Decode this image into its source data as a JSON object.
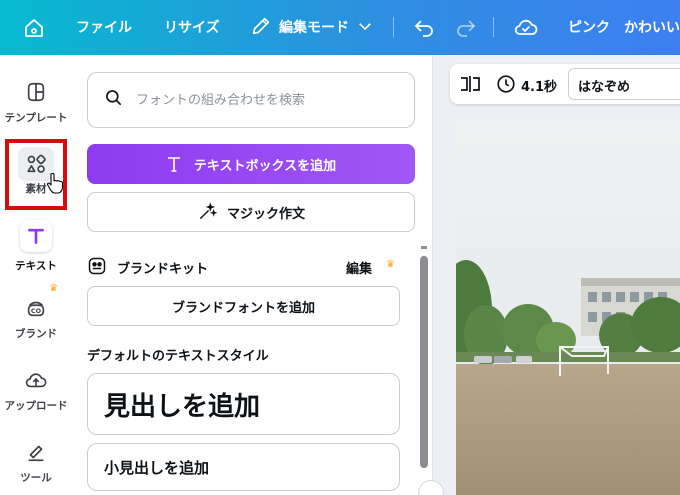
{
  "topbar": {
    "file": "ファイル",
    "resize": "リサイズ",
    "edit_mode": "編集モード",
    "title_a": "ピンク",
    "title_b": "かわいい"
  },
  "rail": {
    "templates": "テンプレート",
    "elements": "素材",
    "text": "テキスト",
    "brand": "ブランド",
    "upload": "アップロード",
    "tools": "ツール"
  },
  "panel": {
    "search_placeholder": "フォントの組み合わせを検索",
    "add_textbox": "テキストボックスを追加",
    "magic_write": "マジック作文",
    "brand_kit": "ブランドキット",
    "edit": "編集",
    "add_brand_font": "ブランドフォントを追加",
    "default_styles": "デフォルトのテキストスタイル",
    "add_heading": "見出しを追加",
    "add_subheading": "小見出しを追加"
  },
  "context": {
    "duration": "4.1秒",
    "font": "はなぞめ"
  },
  "colors": {
    "accent": "#8f3bf0",
    "topbar_start": "#07b9cf",
    "topbar_end": "#3d7ff0",
    "highlight": "#d40e0e"
  }
}
